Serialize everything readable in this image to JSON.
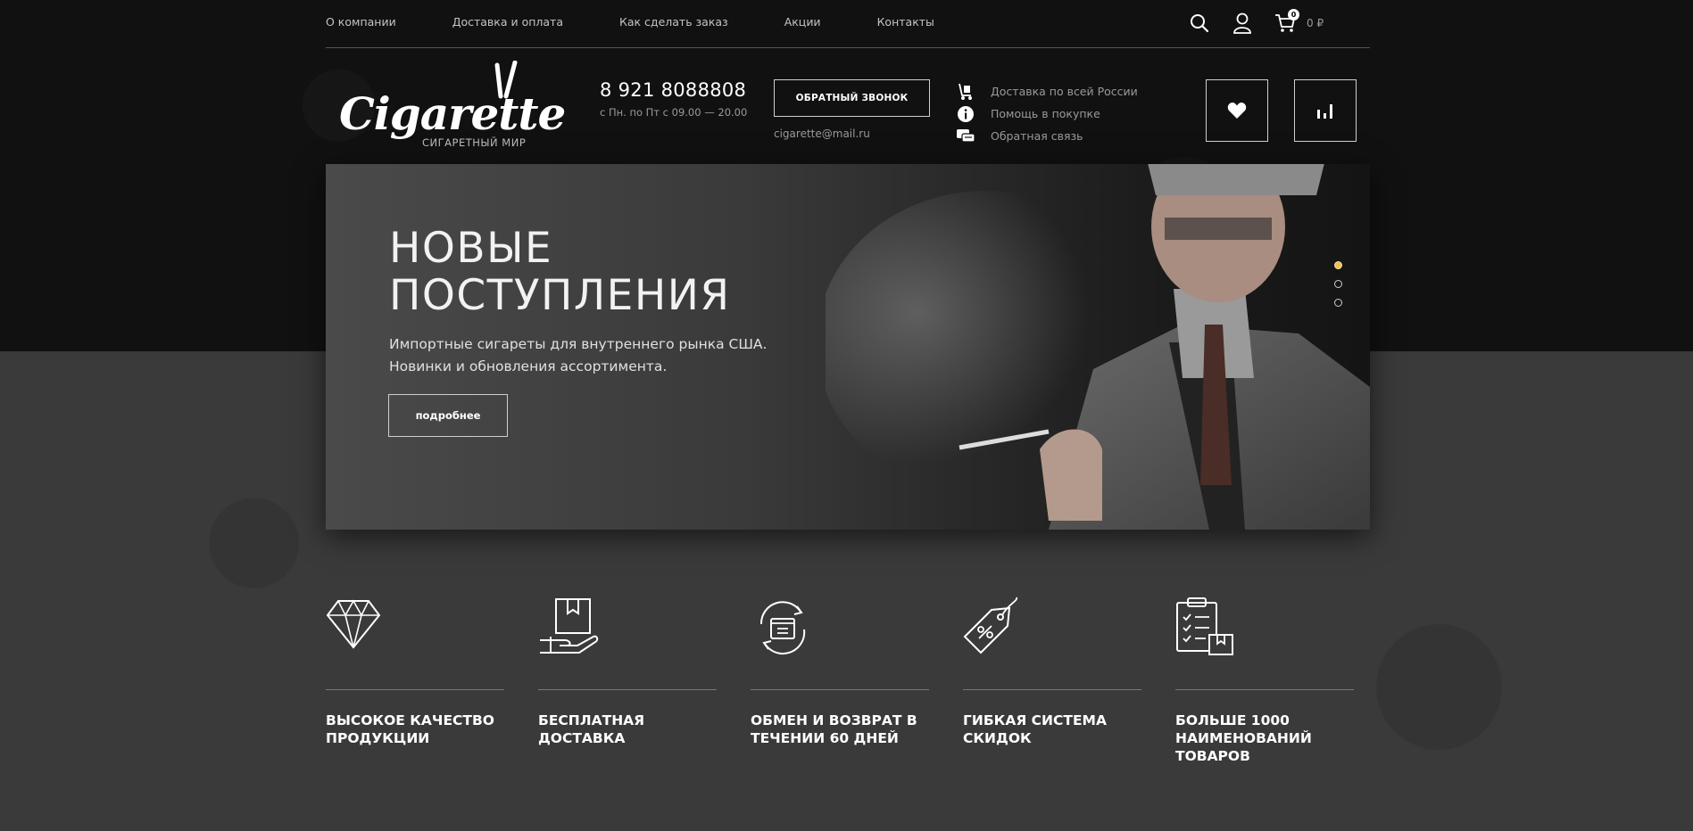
{
  "nav": {
    "items": [
      "О компании",
      "Доставка и оплата",
      "Как сделать заказ",
      "Акции",
      "Контакты"
    ]
  },
  "cart": {
    "count": "0",
    "sum": "0 ₽"
  },
  "header": {
    "logo_text": "Cigarette",
    "logo_sub": "СИГАРЕТНЫЙ МИР",
    "phone": "8 921 8088808",
    "hours": "с Пн. по Пт с 09.00 — 20.00",
    "callback_label": "ОБРАТНЫЙ ЗВОНОК",
    "email": "cigarette@mail.ru",
    "services": [
      {
        "icon": "delivery-cart-icon",
        "label": "Доставка по всей России"
      },
      {
        "icon": "info-icon",
        "label": "Помощь в покупке"
      },
      {
        "icon": "feedback-chat-icon",
        "label": "Обратная связь"
      }
    ]
  },
  "banner": {
    "title": "НОВЫЕ\nПОСТУПЛЕНИЯ",
    "description": "Импортные сигареты для внутреннего рынка США.\nНовинки и обновления ассортимента.",
    "button_label": "подробнее",
    "slides_count": 3,
    "active_slide": 0
  },
  "features": [
    {
      "icon": "diamond-icon",
      "title": "ВЫСОКОЕ КАЧЕСТВО ПРОДУКЦИИ"
    },
    {
      "icon": "box-in-hand-icon",
      "title": "БЕСПЛАТНАЯ ДОСТАВКА"
    },
    {
      "icon": "exchange-return-icon",
      "title": "ОБМЕН И ВОЗВРАТ В ТЕЧЕНИИ 60 ДНЕЙ"
    },
    {
      "icon": "discount-tag-icon",
      "title": "ГИБКАЯ СИСТЕМА СКИДОК"
    },
    {
      "icon": "clipboard-checklist-icon",
      "title": "БОЛЬШЕ 1000 НАИМЕНОВАНИЙ ТОВАРОВ"
    }
  ],
  "colors": {
    "accent_dot": "#f2c04e",
    "dark_bg": "#111111",
    "lower_bg": "#3a3a3a"
  }
}
